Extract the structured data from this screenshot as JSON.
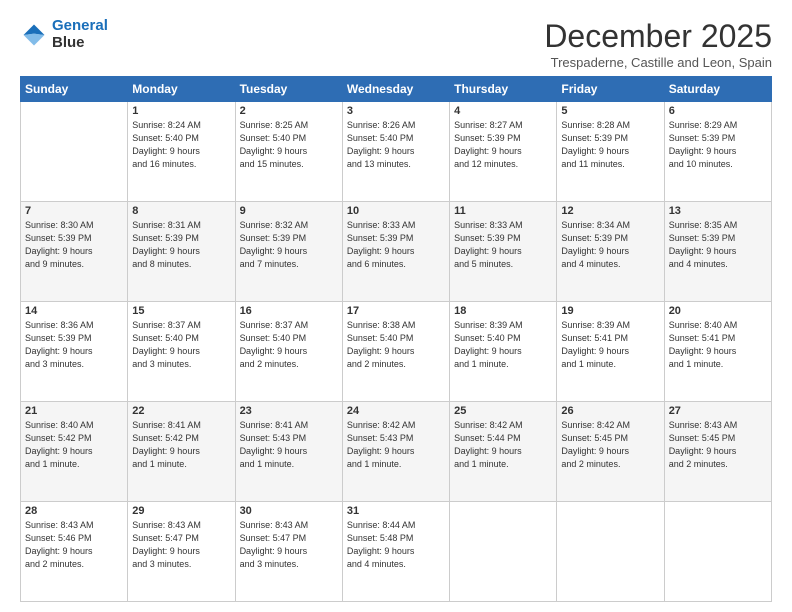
{
  "logo": {
    "line1": "General",
    "line2": "Blue"
  },
  "title": "December 2025",
  "subtitle": "Trespaderne, Castille and Leon, Spain",
  "days_of_week": [
    "Sunday",
    "Monday",
    "Tuesday",
    "Wednesday",
    "Thursday",
    "Friday",
    "Saturday"
  ],
  "weeks": [
    [
      {
        "num": "",
        "info": ""
      },
      {
        "num": "1",
        "info": "Sunrise: 8:24 AM\nSunset: 5:40 PM\nDaylight: 9 hours\nand 16 minutes."
      },
      {
        "num": "2",
        "info": "Sunrise: 8:25 AM\nSunset: 5:40 PM\nDaylight: 9 hours\nand 15 minutes."
      },
      {
        "num": "3",
        "info": "Sunrise: 8:26 AM\nSunset: 5:40 PM\nDaylight: 9 hours\nand 13 minutes."
      },
      {
        "num": "4",
        "info": "Sunrise: 8:27 AM\nSunset: 5:39 PM\nDaylight: 9 hours\nand 12 minutes."
      },
      {
        "num": "5",
        "info": "Sunrise: 8:28 AM\nSunset: 5:39 PM\nDaylight: 9 hours\nand 11 minutes."
      },
      {
        "num": "6",
        "info": "Sunrise: 8:29 AM\nSunset: 5:39 PM\nDaylight: 9 hours\nand 10 minutes."
      }
    ],
    [
      {
        "num": "7",
        "info": "Sunrise: 8:30 AM\nSunset: 5:39 PM\nDaylight: 9 hours\nand 9 minutes."
      },
      {
        "num": "8",
        "info": "Sunrise: 8:31 AM\nSunset: 5:39 PM\nDaylight: 9 hours\nand 8 minutes."
      },
      {
        "num": "9",
        "info": "Sunrise: 8:32 AM\nSunset: 5:39 PM\nDaylight: 9 hours\nand 7 minutes."
      },
      {
        "num": "10",
        "info": "Sunrise: 8:33 AM\nSunset: 5:39 PM\nDaylight: 9 hours\nand 6 minutes."
      },
      {
        "num": "11",
        "info": "Sunrise: 8:33 AM\nSunset: 5:39 PM\nDaylight: 9 hours\nand 5 minutes."
      },
      {
        "num": "12",
        "info": "Sunrise: 8:34 AM\nSunset: 5:39 PM\nDaylight: 9 hours\nand 4 minutes."
      },
      {
        "num": "13",
        "info": "Sunrise: 8:35 AM\nSunset: 5:39 PM\nDaylight: 9 hours\nand 4 minutes."
      }
    ],
    [
      {
        "num": "14",
        "info": "Sunrise: 8:36 AM\nSunset: 5:39 PM\nDaylight: 9 hours\nand 3 minutes."
      },
      {
        "num": "15",
        "info": "Sunrise: 8:37 AM\nSunset: 5:40 PM\nDaylight: 9 hours\nand 3 minutes."
      },
      {
        "num": "16",
        "info": "Sunrise: 8:37 AM\nSunset: 5:40 PM\nDaylight: 9 hours\nand 2 minutes."
      },
      {
        "num": "17",
        "info": "Sunrise: 8:38 AM\nSunset: 5:40 PM\nDaylight: 9 hours\nand 2 minutes."
      },
      {
        "num": "18",
        "info": "Sunrise: 8:39 AM\nSunset: 5:40 PM\nDaylight: 9 hours\nand 1 minute."
      },
      {
        "num": "19",
        "info": "Sunrise: 8:39 AM\nSunset: 5:41 PM\nDaylight: 9 hours\nand 1 minute."
      },
      {
        "num": "20",
        "info": "Sunrise: 8:40 AM\nSunset: 5:41 PM\nDaylight: 9 hours\nand 1 minute."
      }
    ],
    [
      {
        "num": "21",
        "info": "Sunrise: 8:40 AM\nSunset: 5:42 PM\nDaylight: 9 hours\nand 1 minute."
      },
      {
        "num": "22",
        "info": "Sunrise: 8:41 AM\nSunset: 5:42 PM\nDaylight: 9 hours\nand 1 minute."
      },
      {
        "num": "23",
        "info": "Sunrise: 8:41 AM\nSunset: 5:43 PM\nDaylight: 9 hours\nand 1 minute."
      },
      {
        "num": "24",
        "info": "Sunrise: 8:42 AM\nSunset: 5:43 PM\nDaylight: 9 hours\nand 1 minute."
      },
      {
        "num": "25",
        "info": "Sunrise: 8:42 AM\nSunset: 5:44 PM\nDaylight: 9 hours\nand 1 minute."
      },
      {
        "num": "26",
        "info": "Sunrise: 8:42 AM\nSunset: 5:45 PM\nDaylight: 9 hours\nand 2 minutes."
      },
      {
        "num": "27",
        "info": "Sunrise: 8:43 AM\nSunset: 5:45 PM\nDaylight: 9 hours\nand 2 minutes."
      }
    ],
    [
      {
        "num": "28",
        "info": "Sunrise: 8:43 AM\nSunset: 5:46 PM\nDaylight: 9 hours\nand 2 minutes."
      },
      {
        "num": "29",
        "info": "Sunrise: 8:43 AM\nSunset: 5:47 PM\nDaylight: 9 hours\nand 3 minutes."
      },
      {
        "num": "30",
        "info": "Sunrise: 8:43 AM\nSunset: 5:47 PM\nDaylight: 9 hours\nand 3 minutes."
      },
      {
        "num": "31",
        "info": "Sunrise: 8:44 AM\nSunset: 5:48 PM\nDaylight: 9 hours\nand 4 minutes."
      },
      {
        "num": "",
        "info": ""
      },
      {
        "num": "",
        "info": ""
      },
      {
        "num": "",
        "info": ""
      }
    ]
  ]
}
